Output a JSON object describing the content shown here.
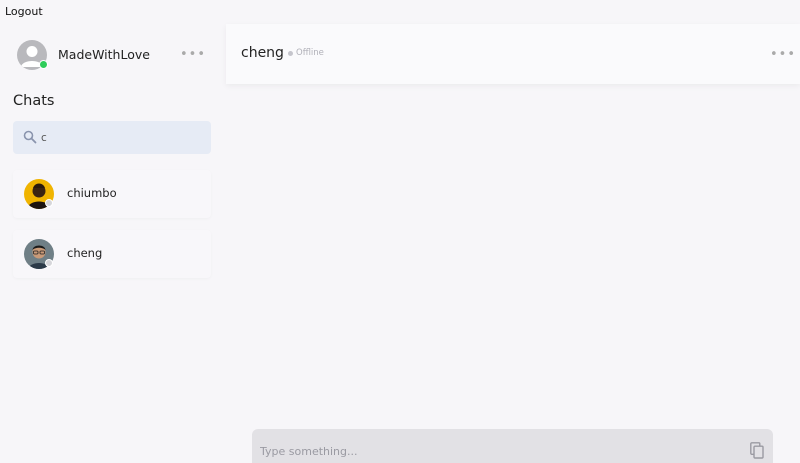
{
  "header": {
    "logout_label": "Logout"
  },
  "sidebar": {
    "current_user": {
      "name": "MadeWithLove",
      "presence_color": "#2ecc5a"
    },
    "menu_icon": "more-horizontal-icon",
    "chats_title": "Chats",
    "search": {
      "value": "c",
      "icon": "search-icon"
    },
    "chats": [
      {
        "name": "chiumbo",
        "avatar": "photo-avatar-yellow"
      },
      {
        "name": "cheng",
        "avatar": "photo-avatar-glasses"
      }
    ]
  },
  "conversation": {
    "title": "cheng",
    "status": "Offline",
    "menu_icon": "more-horizontal-icon"
  },
  "composer": {
    "placeholder": "Type something...",
    "icon": "copy-icon"
  },
  "colors": {
    "background": "#f7f6f9",
    "search_bg": "#e6ebf5",
    "online": "#2ecc5a",
    "composer_bg": "#e2e1e5"
  }
}
